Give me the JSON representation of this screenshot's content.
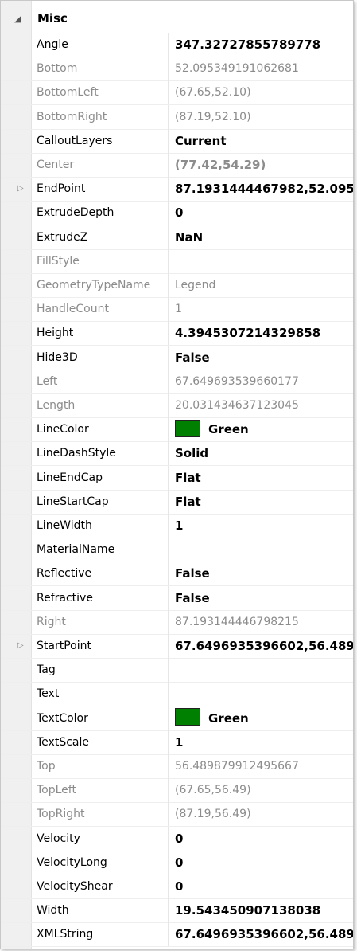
{
  "category": {
    "expander_glyph": "◢",
    "title": "Misc"
  },
  "colors": {
    "green_swatch": "#008000"
  },
  "rows": [
    {
      "name": "Angle",
      "value": "347.32727855789778",
      "bold": true,
      "readonly": false
    },
    {
      "name": "Bottom",
      "value": "52.095349191062681",
      "bold": false,
      "readonly": true
    },
    {
      "name": "BottomLeft",
      "value": "(67.65,52.10)",
      "bold": false,
      "readonly": true
    },
    {
      "name": "BottomRight",
      "value": "(87.19,52.10)",
      "bold": false,
      "readonly": true
    },
    {
      "name": "CalloutLayers",
      "value": "Current",
      "bold": true,
      "readonly": false
    },
    {
      "name": "Center",
      "value": "(77.42,54.29)",
      "bold": true,
      "readonly": true
    },
    {
      "name": "EndPoint",
      "value": "87.1931444467982,52.095",
      "bold": true,
      "readonly": false,
      "expandable": true
    },
    {
      "name": "ExtrudeDepth",
      "value": "0",
      "bold": true,
      "readonly": false
    },
    {
      "name": "ExtrudeZ",
      "value": "NaN",
      "bold": true,
      "readonly": false
    },
    {
      "name": "FillStyle",
      "value": "",
      "bold": false,
      "readonly": true
    },
    {
      "name": "GeometryTypeName",
      "value": "Legend",
      "bold": false,
      "readonly": true
    },
    {
      "name": "HandleCount",
      "value": "1",
      "bold": false,
      "readonly": true
    },
    {
      "name": "Height",
      "value": "4.3945307214329858",
      "bold": true,
      "readonly": false
    },
    {
      "name": "Hide3D",
      "value": "False",
      "bold": true,
      "readonly": false
    },
    {
      "name": "Left",
      "value": "67.649693539660177",
      "bold": false,
      "readonly": true
    },
    {
      "name": "Length",
      "value": "20.031434637123045",
      "bold": false,
      "readonly": true
    },
    {
      "name": "LineColor",
      "value": "Green",
      "bold": true,
      "readonly": false,
      "swatch": "#008000"
    },
    {
      "name": "LineDashStyle",
      "value": "Solid",
      "bold": true,
      "readonly": false
    },
    {
      "name": "LineEndCap",
      "value": "Flat",
      "bold": true,
      "readonly": false
    },
    {
      "name": "LineStartCap",
      "value": "Flat",
      "bold": true,
      "readonly": false
    },
    {
      "name": "LineWidth",
      "value": "1",
      "bold": true,
      "readonly": false
    },
    {
      "name": "MaterialName",
      "value": "",
      "bold": false,
      "readonly": false
    },
    {
      "name": "Reflective",
      "value": "False",
      "bold": true,
      "readonly": false
    },
    {
      "name": "Refractive",
      "value": "False",
      "bold": true,
      "readonly": false
    },
    {
      "name": "Right",
      "value": "87.193144446798215",
      "bold": false,
      "readonly": true
    },
    {
      "name": "StartPoint",
      "value": "67.6496935396602,56.489",
      "bold": true,
      "readonly": false,
      "expandable": true
    },
    {
      "name": "Tag",
      "value": "",
      "bold": false,
      "readonly": false
    },
    {
      "name": "Text",
      "value": "",
      "bold": false,
      "readonly": false
    },
    {
      "name": "TextColor",
      "value": "Green",
      "bold": true,
      "readonly": false,
      "swatch": "#008000"
    },
    {
      "name": "TextScale",
      "value": "1",
      "bold": true,
      "readonly": false
    },
    {
      "name": "Top",
      "value": "56.489879912495667",
      "bold": false,
      "readonly": true
    },
    {
      "name": "TopLeft",
      "value": "(67.65,56.49)",
      "bold": false,
      "readonly": true
    },
    {
      "name": "TopRight",
      "value": "(87.19,56.49)",
      "bold": false,
      "readonly": true
    },
    {
      "name": "Velocity",
      "value": "0",
      "bold": true,
      "readonly": false
    },
    {
      "name": "VelocityLong",
      "value": "0",
      "bold": true,
      "readonly": false
    },
    {
      "name": "VelocityShear",
      "value": "0",
      "bold": true,
      "readonly": false
    },
    {
      "name": "Width",
      "value": "19.543450907138038",
      "bold": true,
      "readonly": false
    },
    {
      "name": "XMLString",
      "value": "67.6496935396602,56.489",
      "bold": true,
      "readonly": false
    }
  ]
}
